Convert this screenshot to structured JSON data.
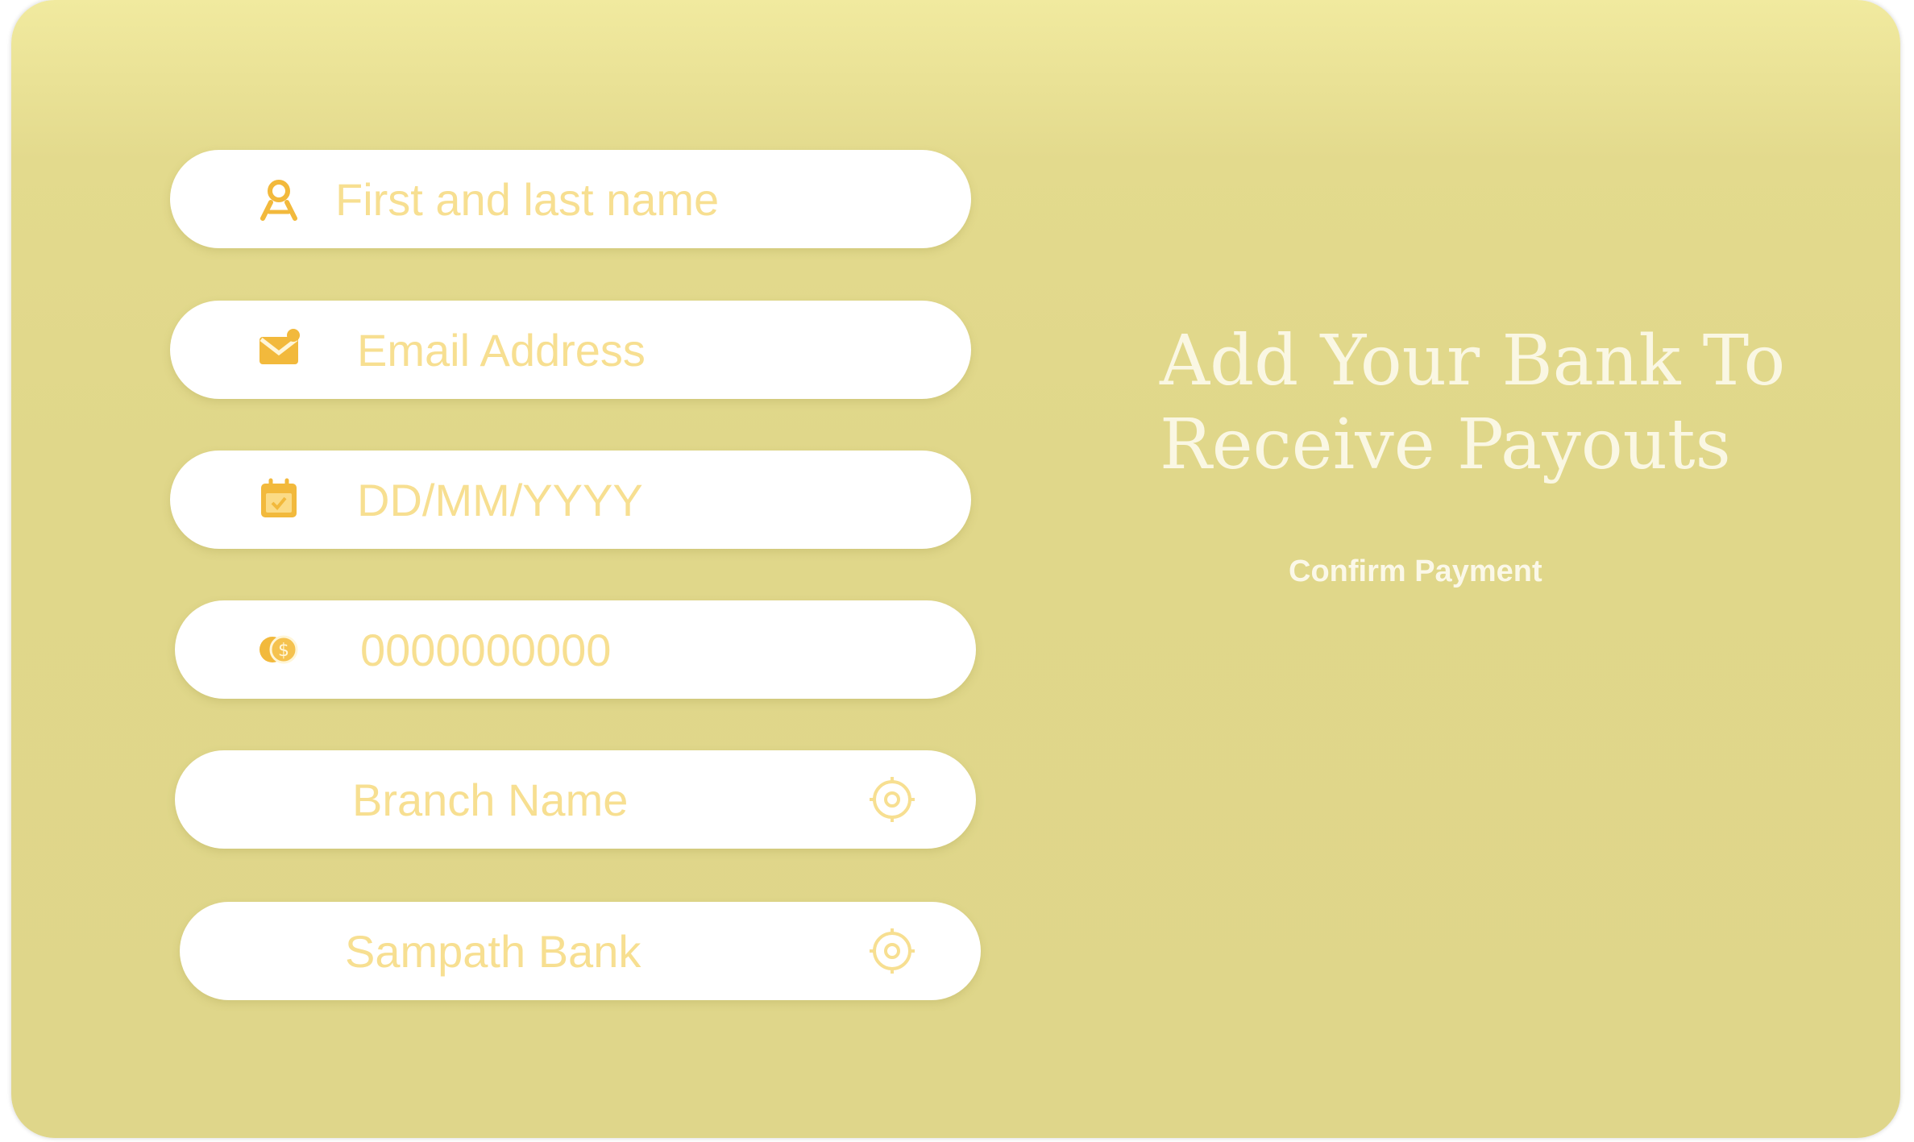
{
  "form": {
    "name_field": {
      "placeholder": "First and last name",
      "value": "",
      "icon": "user-icon"
    },
    "email_field": {
      "placeholder": "Email Address",
      "value": "",
      "icon": "envelope-icon"
    },
    "date_field": {
      "placeholder": "DD/MM/YYYY",
      "value": "",
      "icon": "calendar-icon"
    },
    "account_field": {
      "placeholder": "0000000000",
      "value": "",
      "icon": "coins-icon"
    },
    "branch_field": {
      "placeholder": "Branch Name",
      "value": "",
      "icon": "location-icon"
    },
    "bank_field": {
      "placeholder": "Sampath Bank",
      "value": "",
      "icon": "location-icon"
    }
  },
  "panel": {
    "heading_line1": "Add Your Bank To",
    "heading_line2": "Receive Payouts",
    "confirm_label": "Confirm Payment"
  },
  "colors": {
    "card_background": "#e0d78a",
    "card_top": "#f1ea9f",
    "field_background": "#ffffff",
    "accent": "#f2c94c",
    "placeholder": "#f7df91",
    "heading_text": "#faf7e3"
  }
}
